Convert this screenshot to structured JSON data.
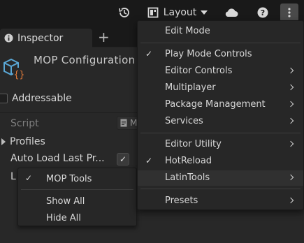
{
  "toolbar": {
    "layout_label": "Layout",
    "icons": [
      "history-icon",
      "layout-icon",
      "cloud-icon",
      "help-icon",
      "more-vertical-icon"
    ]
  },
  "panel": {
    "tab_label": "Inspector",
    "object_title": "MOP Configuration",
    "addressable_label": "Addressable",
    "fields": {
      "script_label": "Script",
      "script_value": "M",
      "profiles_label": "Profiles",
      "auto_load_label": "Auto Load Last Pr...",
      "auto_load_checked": true,
      "truncated_label": "L"
    }
  },
  "context_submenu": {
    "items": [
      {
        "label": "MOP Tools",
        "checked": true
      },
      {
        "label": "Show All",
        "checked": false
      },
      {
        "label": "Hide All",
        "checked": false
      }
    ]
  },
  "main_menu": {
    "items": [
      {
        "label": "Edit Mode",
        "checked": false,
        "submenu": false
      },
      {
        "label": "Play Mode Controls",
        "checked": true,
        "submenu": false
      },
      {
        "label": "Editor Controls",
        "checked": false,
        "submenu": true
      },
      {
        "label": "Multiplayer",
        "checked": false,
        "submenu": true
      },
      {
        "label": "Package Management",
        "checked": false,
        "submenu": true
      },
      {
        "label": "Services",
        "checked": false,
        "submenu": true
      },
      {
        "label": "Editor Utility",
        "checked": false,
        "submenu": true
      },
      {
        "label": "HotReload",
        "checked": true,
        "submenu": false
      },
      {
        "label": "LatinTools",
        "checked": false,
        "submenu": true,
        "highlighted": true
      },
      {
        "label": "Presets",
        "checked": false,
        "submenu": true
      }
    ]
  },
  "glyphs": {
    "check": "✓",
    "plus": "+",
    "help": "?"
  }
}
